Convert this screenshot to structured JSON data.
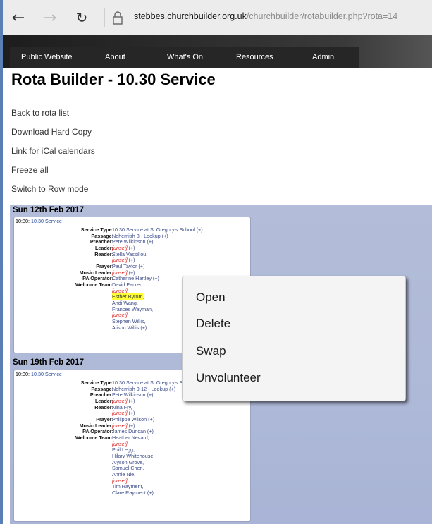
{
  "browser": {
    "url_host": "stebbes.churchbuilder.org.uk",
    "url_path": "/churchbuilder/rotabuilder.php?rota=14",
    "icons": [
      "back-icon",
      "forward-icon",
      "refresh-icon",
      "lock-icon"
    ]
  },
  "nav": {
    "items": [
      "Public Website",
      "About",
      "What's On",
      "Resources",
      "Admin"
    ]
  },
  "page": {
    "title": "Rota Builder - 10.30 Service",
    "links": [
      "Back to rota list",
      "Download Hard Copy",
      "Link for iCal calendars",
      "Freeze all",
      "Switch to Row mode"
    ]
  },
  "weeks": [
    {
      "date": "Sun 12th Feb 2017",
      "time": "10:30:",
      "service": "10.30 Service",
      "labels": [
        "Service Type:",
        "Passage:",
        "Preacher:",
        "Leader:",
        "Reader:",
        "Prayer:",
        "Music Leader:",
        "PA Operator:",
        "Welcome Team:"
      ],
      "lines": [
        "10:30 Service at St Gregory's School (+)",
        "Nehemiah 8 - Lookup (+)",
        "Pete Wilkinson (+)",
        "(+)",
        "Stella Vassiliou,",
        "(+)",
        "Paul Taylor (+)",
        "(+)",
        "Catherine Hartley (+)",
        "David Parker,",
        ",",
        "Esther Byrom",
        "Andi Wang,",
        "Frances Wayman,",
        ",",
        "Stephen Willis,",
        "Alison Willis (+)"
      ]
    },
    {
      "date": "Sun 19th Feb 2017",
      "time": "10:30:",
      "service": "10.30 Service",
      "labels": [
        "Service Type:",
        "Passage:",
        "Preacher:",
        "Leader:",
        "Reader:",
        "Prayer:",
        "Music Leader:",
        "PA Operator:",
        "Welcome Team:"
      ],
      "lines": [
        "10:30 Service at St Gregory's School (+)",
        "Nehemiah 9-12 - Lookup (+)",
        "Pete Wilkinson (+)",
        "(+)",
        "Nina Fry,",
        "(+)",
        "Philippa Wilson (+)",
        "(+)",
        "James Duncan (+)",
        "Heather Nevard,",
        ",",
        "Phil Legg,",
        "Hilary Whitehouse,",
        "Alyson Grove,",
        "Samuel Chen,",
        "Annie Nie,",
        ",",
        "Tim Rayment,",
        "Clare Rayment (+)"
      ]
    }
  ],
  "unset_label": "[unset]",
  "context_menu": {
    "items": [
      "Open",
      "Delete",
      "Swap",
      "Unvolunteer"
    ]
  }
}
